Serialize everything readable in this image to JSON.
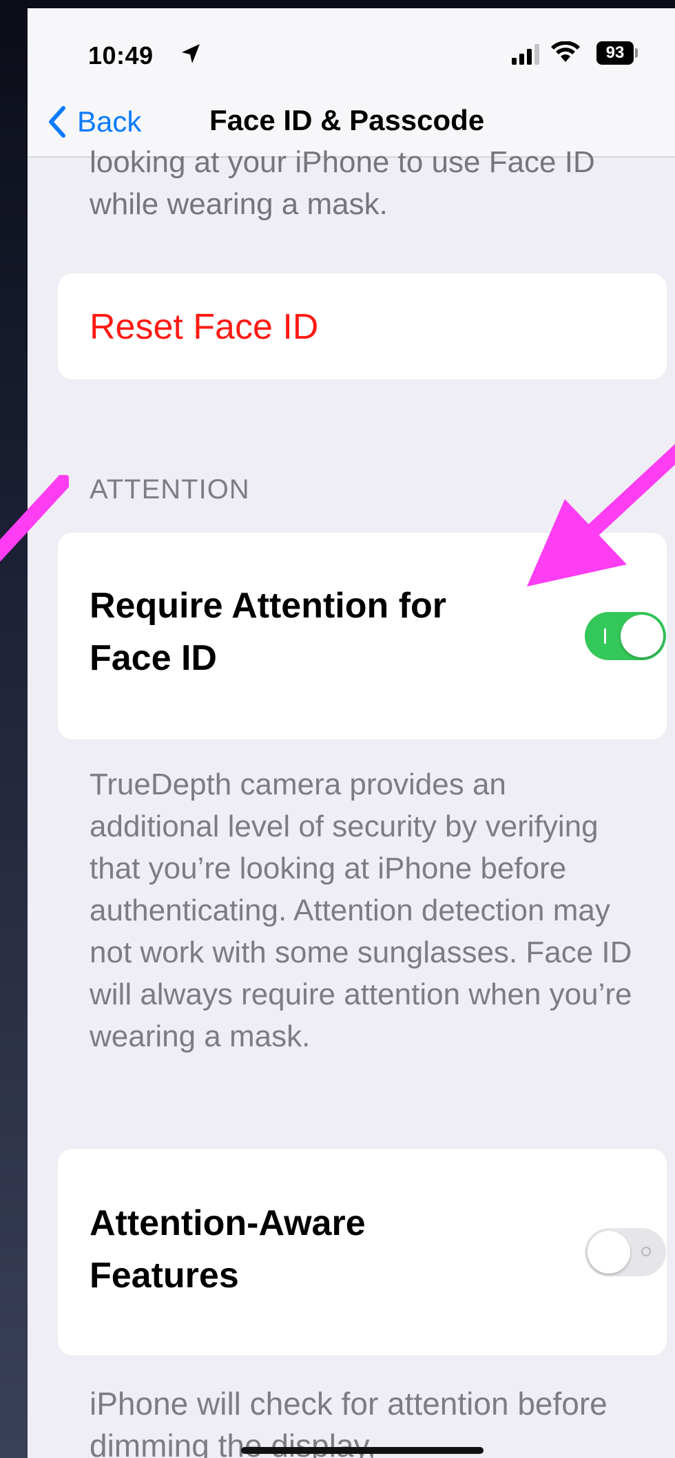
{
  "status_bar": {
    "time": "10:49",
    "battery": "93",
    "icons": [
      "location-arrow-icon",
      "signal-icon",
      "wifi-icon",
      "battery-icon"
    ]
  },
  "nav": {
    "back_label": "Back",
    "title": "Face ID & Passcode"
  },
  "content": {
    "top_footer": "looking at your iPhone to use Face ID while wearing a mask.",
    "reset_label": "Reset Face ID",
    "attention_header": "ATTENTION",
    "require_attention": {
      "label": "Require Attention for Face ID",
      "enabled": true
    },
    "attention_footer": "TrueDepth camera provides an additional level of security by verifying that you’re looking at iPhone before authenticating. Attention detection may not work with some sunglasses. Face ID will always require attention when you’re wearing a mask.",
    "attention_aware": {
      "label": "Attention-Aware Features",
      "enabled": false
    },
    "aware_footer": "iPhone will check for attention before dimming the display,"
  },
  "colors": {
    "accent_blue": "#0a7aff",
    "destructive_red": "#ff1a14",
    "toggle_green": "#34c759",
    "annotation_magenta": "#ff3df2"
  }
}
